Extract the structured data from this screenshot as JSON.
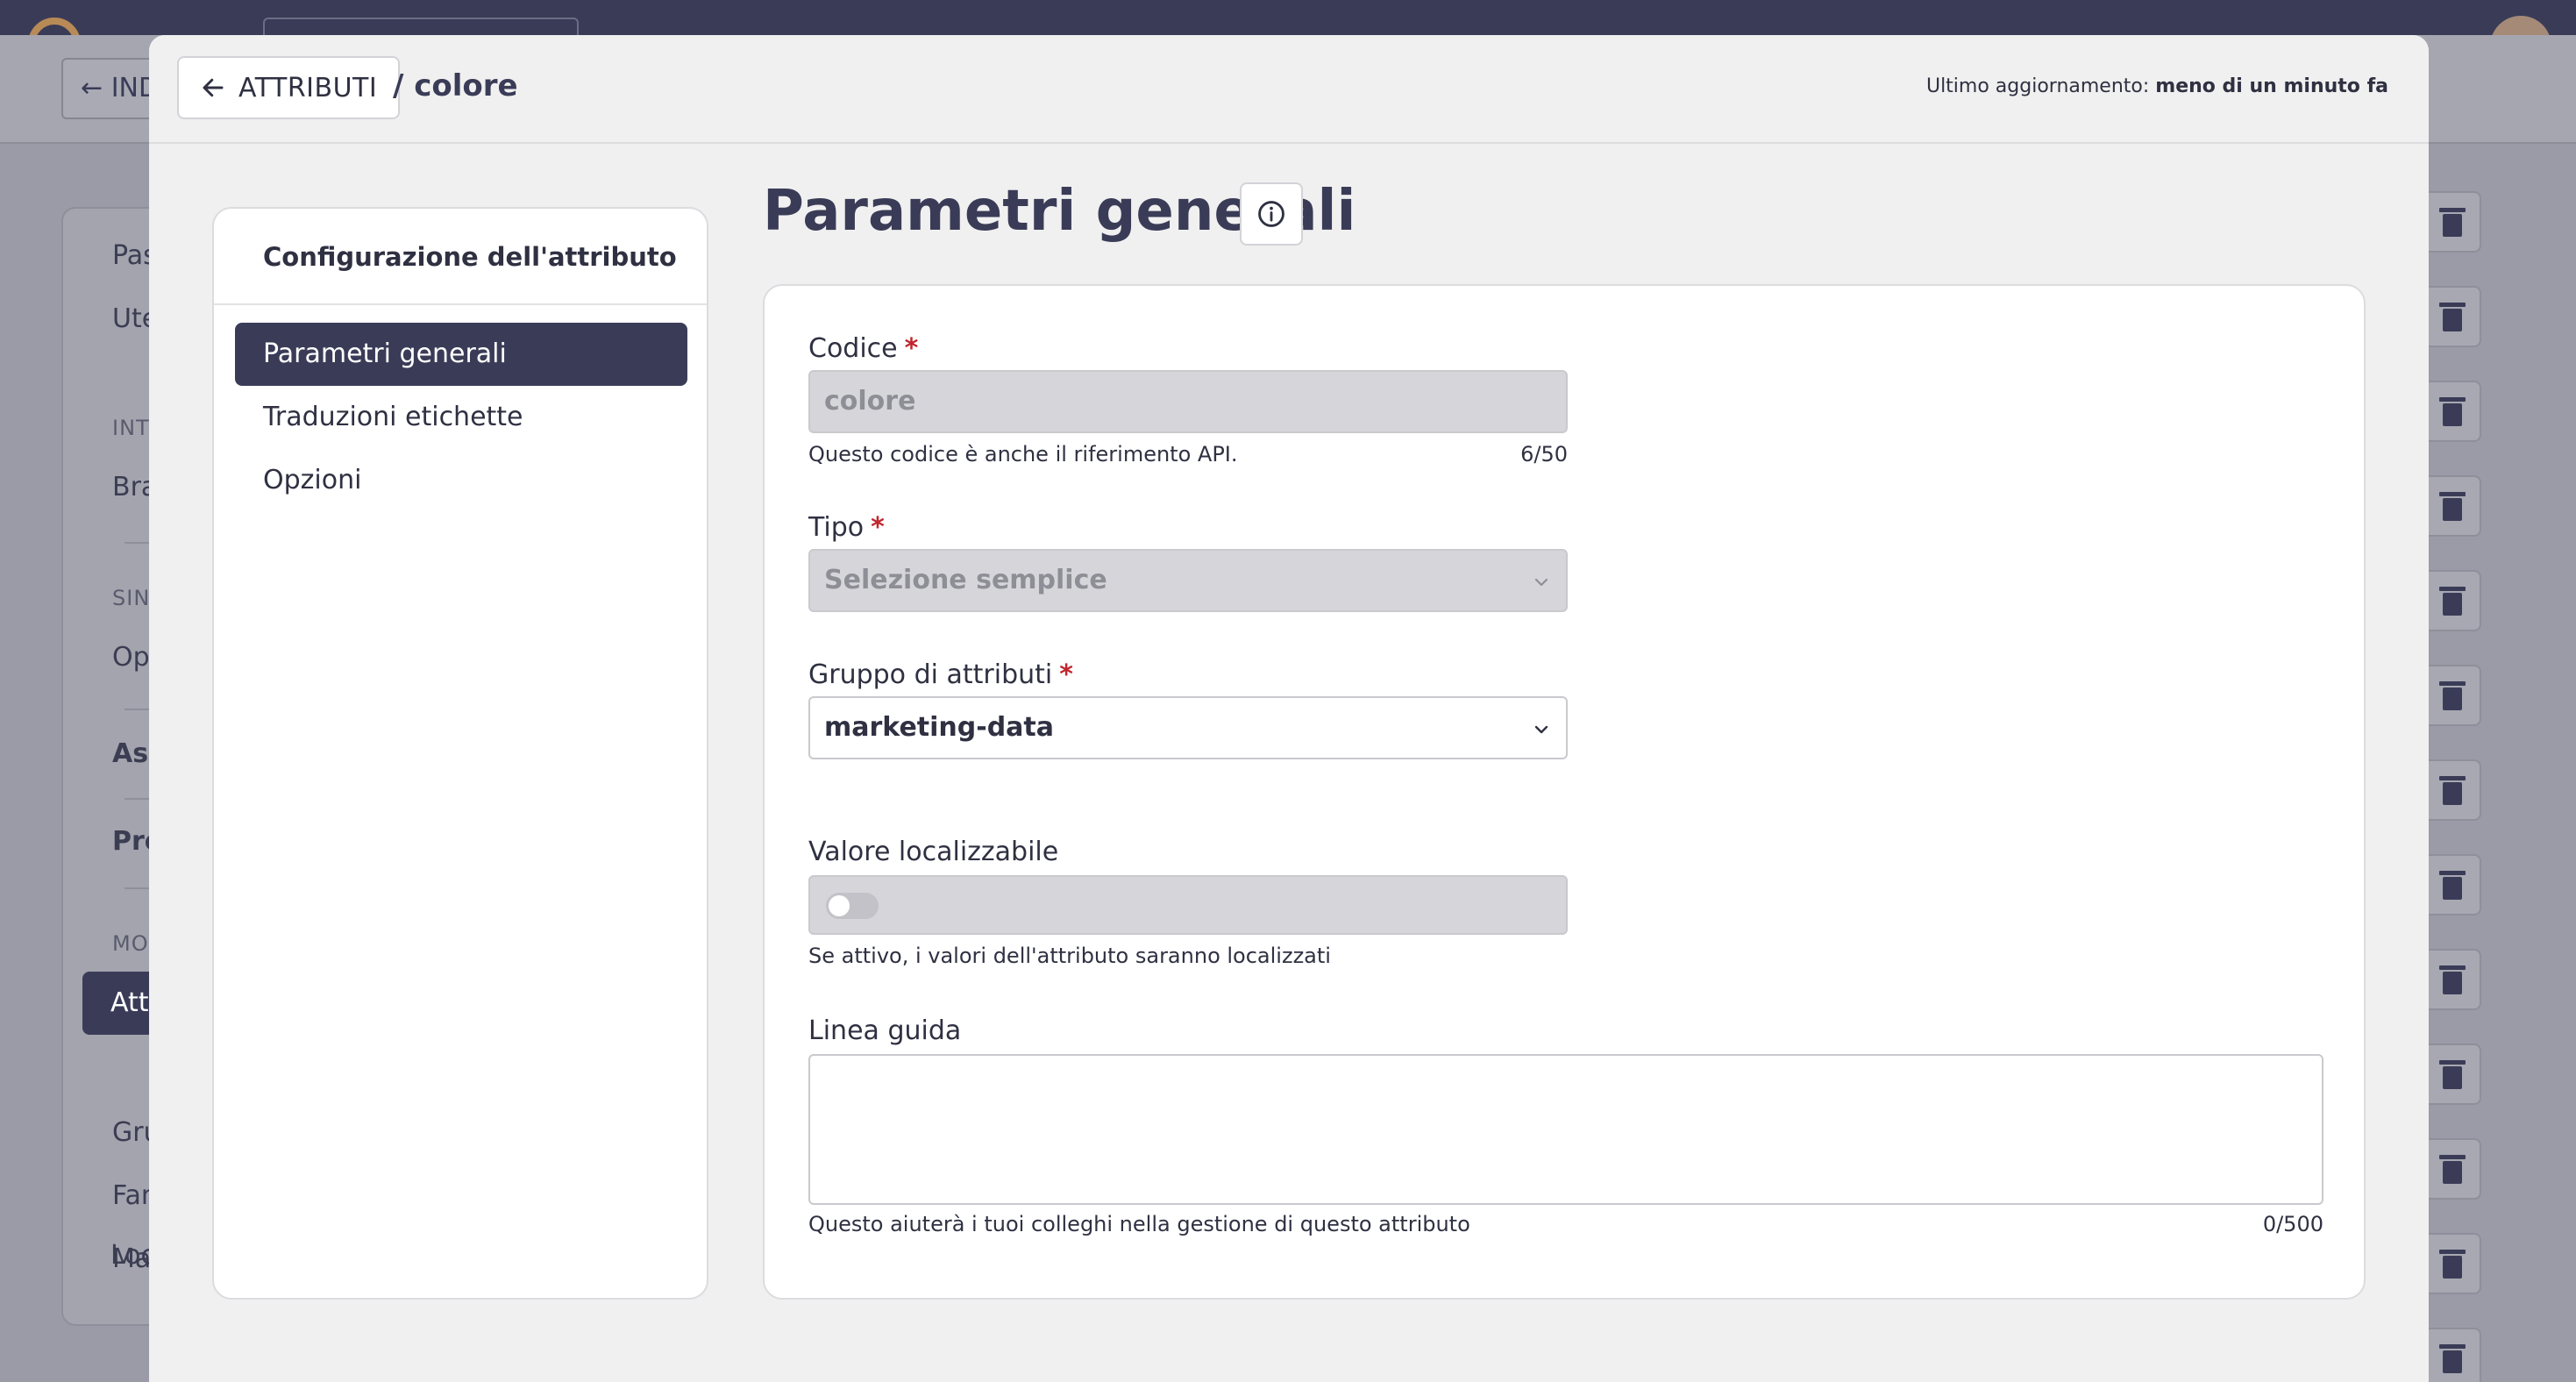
{
  "background": {
    "back_label": "IND",
    "sidebar_items": [
      {
        "label": "Pas"
      },
      {
        "label": "Ute"
      },
      {
        "label": "INT"
      },
      {
        "label": "Bra"
      },
      {
        "label": "SIN"
      },
      {
        "label": "Ope"
      },
      {
        "label": "Ass"
      },
      {
        "label": "Pro"
      },
      {
        "label": "MO"
      },
      {
        "label": "Attr"
      },
      {
        "label": "Gru"
      },
      {
        "label": "Fan"
      },
      {
        "label": "Ma"
      },
      {
        "label": "Loc"
      }
    ]
  },
  "header": {
    "back_label": "ATTRIBUTI",
    "breadcrumb": "/  colore",
    "updated_label": "Ultimo aggiornamento:",
    "updated_value": "meno di un minuto fa"
  },
  "nav": {
    "title": "Configurazione dell'attributo",
    "items": [
      {
        "label": "Parametri generali",
        "active": true
      },
      {
        "label": "Traduzioni etichette",
        "active": false
      },
      {
        "label": "Opzioni",
        "active": false
      }
    ]
  },
  "main": {
    "title": "Parametri generali",
    "info_icon": "info-circle-icon",
    "codice": {
      "label": "Codice",
      "value": "colore",
      "helper": "Questo codice è anche il riferimento API.",
      "counter": "6/50"
    },
    "tipo": {
      "label": "Tipo",
      "value": "Selezione semplice"
    },
    "gruppo": {
      "label": "Gruppo di attributi",
      "value": "marketing-data"
    },
    "localizzabile": {
      "label": "Valore localizzabile",
      "enabled": false,
      "helper": "Se attivo, i valori dell'attributo saranno localizzati"
    },
    "linea_guida": {
      "label": "Linea guida",
      "value": "",
      "helper": "Questo aiuterà i tuoi colleghi nella gestione di questo attributo",
      "counter": "0/500"
    }
  },
  "colors": {
    "primary": "#3a3c57",
    "required": "#c0262d",
    "overlay": "#9a9ba6"
  }
}
